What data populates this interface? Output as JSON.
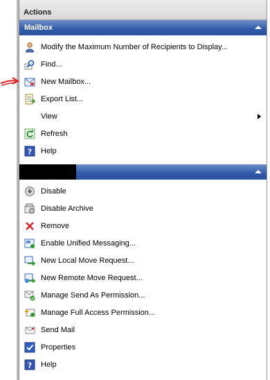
{
  "pane": {
    "title": "Actions"
  },
  "sections": [
    {
      "title": "Mailbox",
      "items": [
        {
          "label": "Modify the Maximum Number of Recipients to Display...",
          "icon": "user-icon"
        },
        {
          "label": "Find...",
          "icon": "find-icon"
        },
        {
          "label": "New Mailbox...",
          "icon": "new-mailbox-icon"
        },
        {
          "label": "Export List...",
          "icon": "export-icon"
        },
        {
          "label": "View",
          "icon": "none",
          "submenu": true
        },
        {
          "label": "Refresh",
          "icon": "refresh-icon"
        },
        {
          "label": "Help",
          "icon": "help-icon"
        }
      ]
    },
    {
      "title": "",
      "items": [
        {
          "label": "Disable",
          "icon": "disable-icon"
        },
        {
          "label": "Disable Archive",
          "icon": "archive-icon"
        },
        {
          "label": "Remove",
          "icon": "remove-icon"
        },
        {
          "label": "Enable Unified Messaging...",
          "icon": "unified-messaging-icon"
        },
        {
          "label": "New Local Move Request...",
          "icon": "local-move-icon"
        },
        {
          "label": "New Remote Move Request...",
          "icon": "remote-move-icon"
        },
        {
          "label": "Manage Send As Permission...",
          "icon": "send-as-icon"
        },
        {
          "label": "Manage Full Access Permission...",
          "icon": "full-access-icon"
        },
        {
          "label": "Send Mail",
          "icon": "mail-icon"
        },
        {
          "label": "Properties",
          "icon": "properties-icon"
        },
        {
          "label": "Help",
          "icon": "help-icon"
        }
      ]
    }
  ],
  "colors": {
    "header": "#2f5aa8",
    "annotation": "#e02020"
  }
}
